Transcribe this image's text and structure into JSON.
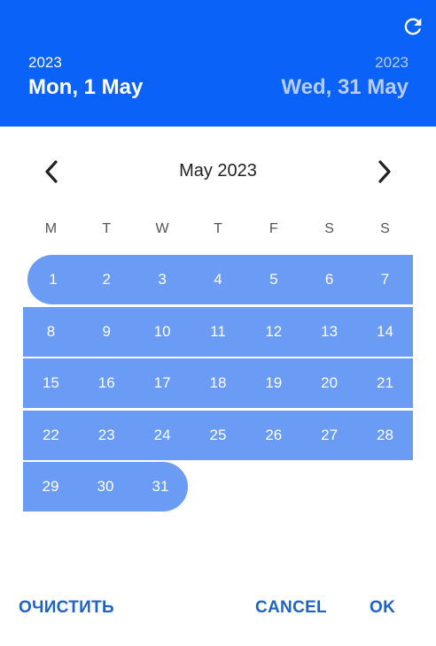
{
  "header": {
    "start_year": "2023",
    "start_date": "Mon, 1 May",
    "end_year": "2023",
    "end_date": "Wed, 31 May",
    "refresh_icon": "refresh-icon"
  },
  "calendar": {
    "month_title": "May 2023",
    "prev_icon": "chevron-left-icon",
    "next_icon": "chevron-right-icon",
    "weekdays": [
      "M",
      "T",
      "W",
      "T",
      "F",
      "S",
      "S"
    ],
    "weeks": [
      [
        "1",
        "2",
        "3",
        "4",
        "5",
        "6",
        "7"
      ],
      [
        "8",
        "9",
        "10",
        "11",
        "12",
        "13",
        "14"
      ],
      [
        "15",
        "16",
        "17",
        "18",
        "19",
        "20",
        "21"
      ],
      [
        "22",
        "23",
        "24",
        "25",
        "26",
        "27",
        "28"
      ],
      [
        "29",
        "30",
        "31"
      ]
    ],
    "range_color": "#6b9cf5"
  },
  "actions": {
    "clear_label": "ОЧИСТИТЬ",
    "cancel_label": "CANCEL",
    "ok_label": "OK"
  },
  "colors": {
    "header_bg": "#0a62f8",
    "accent_text": "#1c63c6"
  }
}
